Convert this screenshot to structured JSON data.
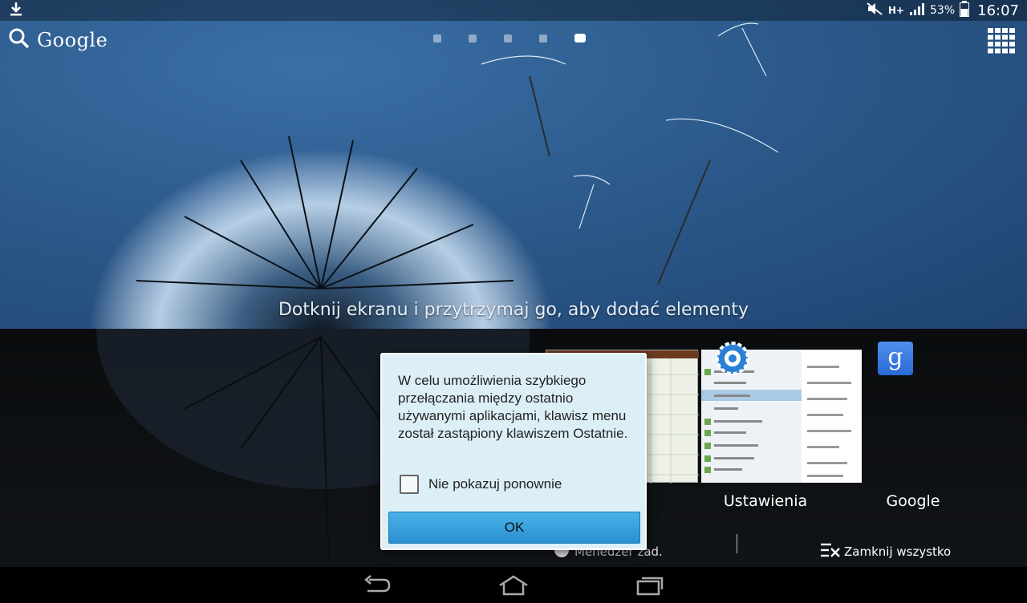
{
  "status_bar": {
    "network": "H+",
    "battery": "53%",
    "time": "16:07"
  },
  "home": {
    "search_label": "Google",
    "hint": "Dotknij ekranu i przytrzymaj go, aby dodać elementy",
    "page_count": 5,
    "active_page": 5
  },
  "recents": {
    "apps": [
      {
        "label": "Ustawienia",
        "icon": "settings-icon"
      },
      {
        "label": "Google",
        "icon": "google-icon"
      }
    ],
    "task_manager": "Menedżer zad.",
    "close_all": "Zamknij wszystko"
  },
  "dialog": {
    "message": "W celu umożliwienia szybkiego przełączania między ostatnio używanymi aplikacjami, klawisz menu został zastąpiony klawiszem Ostatnie.",
    "checkbox_label": "Nie pokazuj ponownie",
    "checkbox_checked": false,
    "ok_label": "OK"
  },
  "nav": {
    "buttons": [
      "back-icon",
      "home-icon",
      "recents-icon"
    ]
  },
  "colors": {
    "dialog_bg": "#dceff7",
    "button_blue": "#2a8fd0",
    "wallpaper_blue": "#2c5a8c"
  }
}
